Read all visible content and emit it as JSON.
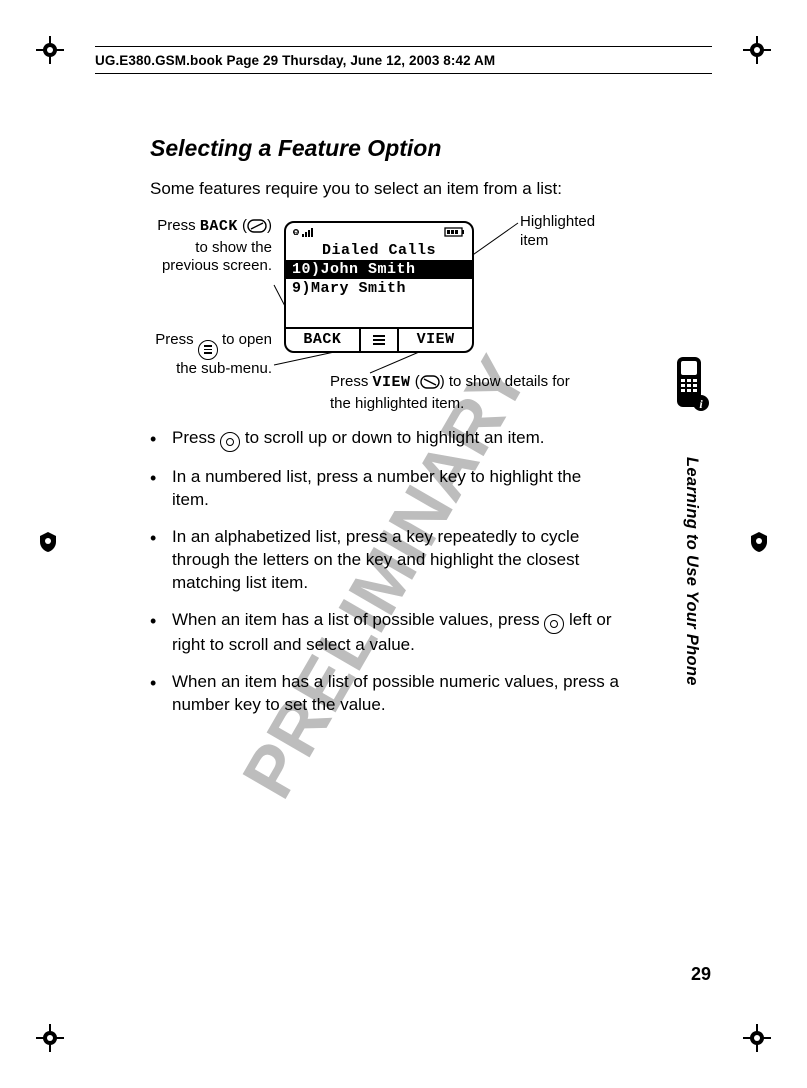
{
  "header": {
    "book_info": "UG.E380.GSM.book  Page 29  Thursday, June 12, 2003  8:42 AM"
  },
  "section": {
    "title": "Selecting a Feature Option",
    "intro": "Some features require you to select an item from a list:"
  },
  "figure": {
    "label_back_a": "Press",
    "label_back_key": "BACK",
    "label_back_b": " to show the previous screen.",
    "label_menu_a": "Press ",
    "label_menu_b": " to open the sub-menu.",
    "label_highlighted": "Highlighted item",
    "label_view_a": "Press ",
    "label_view_key": "VIEW",
    "label_view_b": " to show details for the highlighted item."
  },
  "phone_screen": {
    "title": "Dialed Calls",
    "row1": "10)John Smith",
    "row2": "9)Mary Smith",
    "soft_left": "BACK",
    "soft_right": "VIEW"
  },
  "bullets": {
    "b1a": "Press ",
    "b1b": " to scroll up or down to highlight an item.",
    "b2": "In a numbered list, press a number key to highlight the item.",
    "b3": "In an alphabetized list, press a key repeatedly to cycle through the letters on the key and highlight the closest matching list item.",
    "b4a": "When an item has a list of possible values, press ",
    "b4b": " left or right to scroll and select a value.",
    "b5": "When an item has a list of possible numeric values, press a number key to set the value."
  },
  "sidebar": {
    "chapter": "Learning to Use Your Phone",
    "page": "29"
  },
  "watermark": "PRELIMINARY"
}
